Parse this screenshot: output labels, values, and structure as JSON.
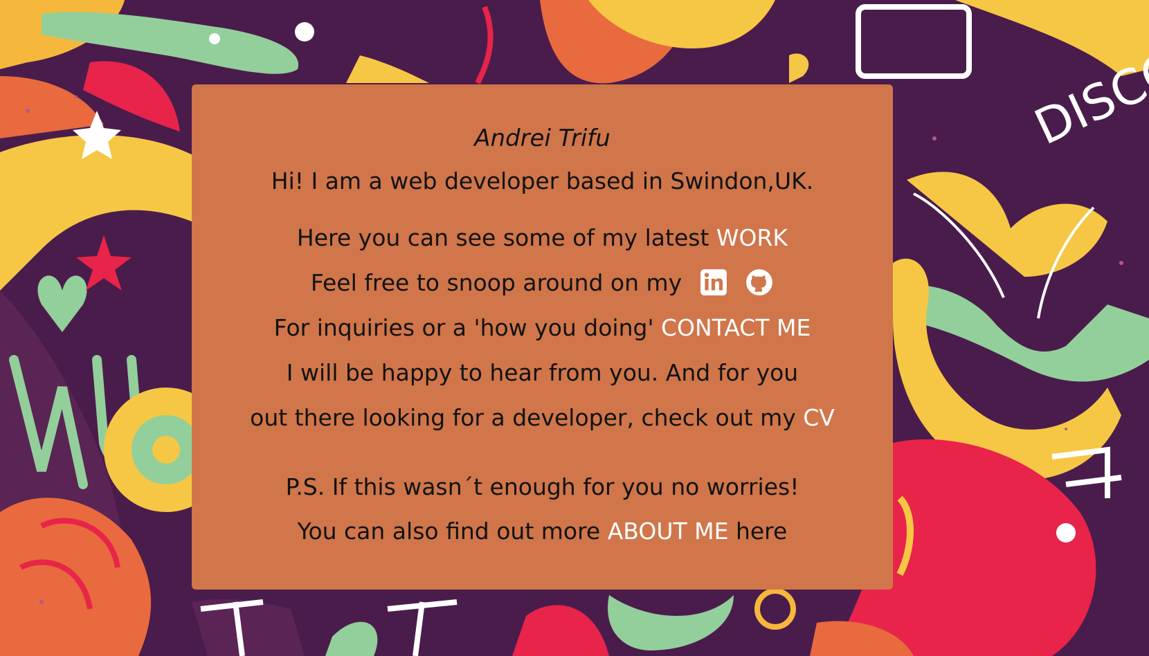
{
  "profile": {
    "name": "Andrei Trifu",
    "intro": "Hi! I am a web developer based in Swindon,UK."
  },
  "lines": {
    "work_prefix": "Here you can see some of my latest ",
    "work_link": "WORK",
    "snoop_prefix": "Feel free to snoop around on my ",
    "contact_prefix": "For inquiries or a 'how you doing' ",
    "contact_link": "CONTACT ME",
    "happy": "I will be happy to hear from you. And for you",
    "cv_prefix": "out there looking for a developer, check out my ",
    "cv_link": "CV",
    "ps": "P.S. If this wasn´t enough for you no worries!",
    "about_prefix": "You can also find out more ",
    "about_link": "ABOUT ME",
    "about_suffix": " here"
  },
  "icons": {
    "linkedin": "linkedin-icon",
    "github": "github-icon"
  },
  "colors": {
    "card": "#d0764a",
    "link": "#ffffff",
    "text": "#121212",
    "background": "#4a1c4c"
  }
}
